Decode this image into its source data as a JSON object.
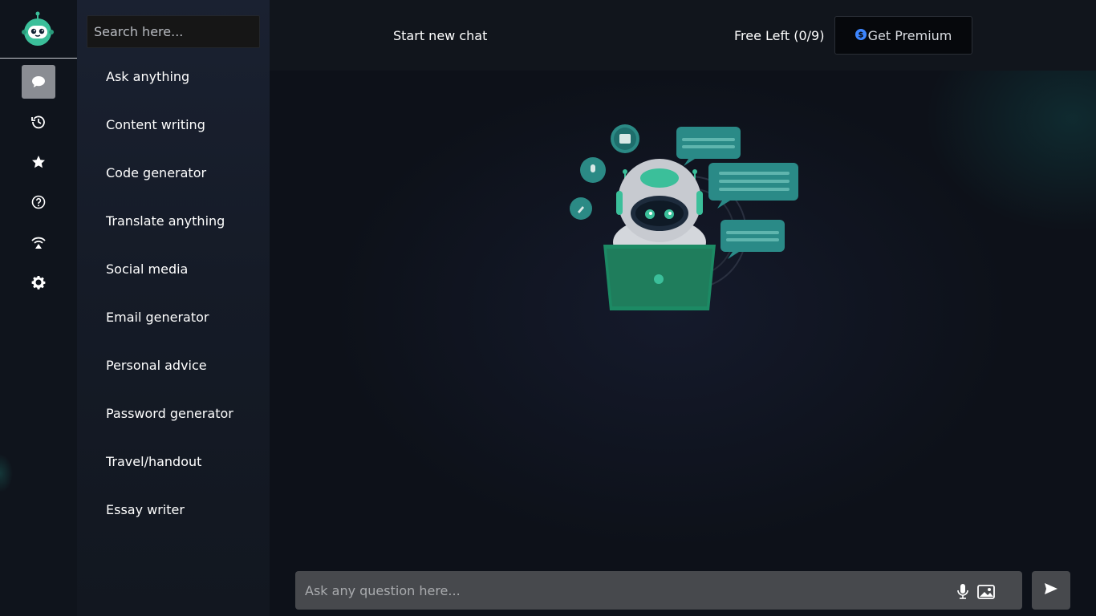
{
  "sidebar": {
    "logo_icon": "robot-logo-icon",
    "nav": [
      {
        "icon": "chat-icon",
        "active": true
      },
      {
        "icon": "history-icon",
        "active": false
      },
      {
        "icon": "star-icon",
        "active": false
      },
      {
        "icon": "help-icon",
        "active": false
      },
      {
        "icon": "broadcast-icon",
        "active": false
      },
      {
        "icon": "gear-icon",
        "active": false
      }
    ]
  },
  "panel": {
    "search_placeholder": "Search here...",
    "categories": [
      "Ask anything",
      "Content writing",
      "Code generator",
      "Translate anything",
      "Social media",
      "Email generator",
      "Personal advice",
      "Password generator",
      "Travel/handout",
      "Essay writer"
    ]
  },
  "header": {
    "new_chat_label": "Start new chat",
    "free_left_label": "Free Left (0/9)",
    "premium_label": "Get Premium",
    "premium_icon": "dollar-coin-icon"
  },
  "main": {
    "illustration": "robot-with-laptop-illustration"
  },
  "composer": {
    "placeholder": "Ask any question here...",
    "mic_icon": "microphone-icon",
    "image_icon": "image-upload-icon",
    "send_icon": "send-icon"
  },
  "colors": {
    "background": "#0d1119",
    "accent": "#3bbf9a",
    "active_nav": "#8a8d93",
    "input_bg": "#47494d"
  }
}
